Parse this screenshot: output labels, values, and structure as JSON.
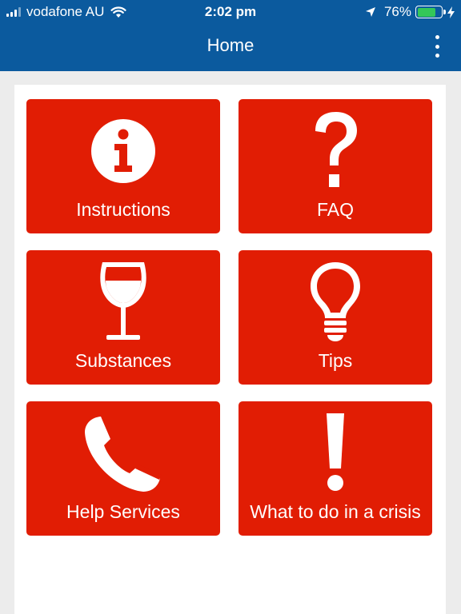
{
  "status_bar": {
    "carrier": "vodafone AU",
    "time": "2:02 pm",
    "battery_percent": "76%",
    "battery_level": 0.76,
    "icons": [
      "signal-icon",
      "wifi-icon",
      "location-arrow-icon",
      "battery-icon",
      "charging-bolt-icon"
    ]
  },
  "header": {
    "title": "Home",
    "menu_icon": "more-vertical-icon"
  },
  "tiles": [
    {
      "label": "Instructions",
      "icon": "info-icon"
    },
    {
      "label": "FAQ",
      "icon": "question-icon"
    },
    {
      "label": "Substances",
      "icon": "wine-glass-icon"
    },
    {
      "label": "Tips",
      "icon": "lightbulb-icon"
    },
    {
      "label": "Help Services",
      "icon": "phone-icon"
    },
    {
      "label": "What to do in a crisis",
      "icon": "exclamation-icon"
    }
  ],
  "colors": {
    "header_bg": "#0b5a9e",
    "tile_bg": "#e11d04",
    "panel_bg": "#ffffff",
    "page_bg": "#ececec",
    "battery_fill": "#34c759"
  }
}
